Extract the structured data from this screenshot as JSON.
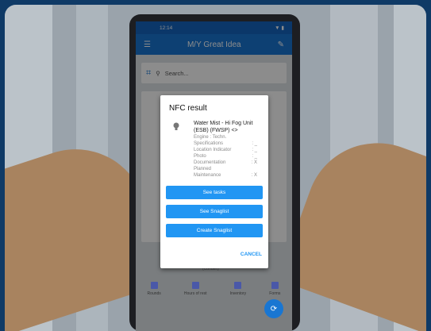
{
  "status": {
    "time": "12:14",
    "icons": "▼ ▮"
  },
  "app": {
    "title": "M/Y Great Idea"
  },
  "search": {
    "placeholder": "Search..."
  },
  "dialog": {
    "title": "NFC result",
    "item": {
      "title": "Water Mist - Hi Fog Unit (ESB) (FWSP) <>",
      "lines": [
        {
          "k": "Engine : Techn.",
          "v": ""
        },
        {
          "k": "Specifications",
          "v": ": _"
        },
        {
          "k": "Location Indicator",
          "v": ": _"
        },
        {
          "k": "Photo",
          "v": ": _"
        },
        {
          "k": "Documentation",
          "v": ": X"
        },
        {
          "k": "Planned",
          "v": ""
        },
        {
          "k": "Maintenance",
          "v": ": X"
        }
      ]
    },
    "buttons": {
      "see_tasks": "See tasks",
      "see_snaglist": "See Snaglist",
      "create_snaglist": "Create Snaglist"
    },
    "cancel": "CANCEL"
  },
  "bottom_nav": [
    "Rounds",
    "Hours of rest",
    "Inventory",
    "Forms"
  ],
  "under_dialog_text": "(Conden)"
}
